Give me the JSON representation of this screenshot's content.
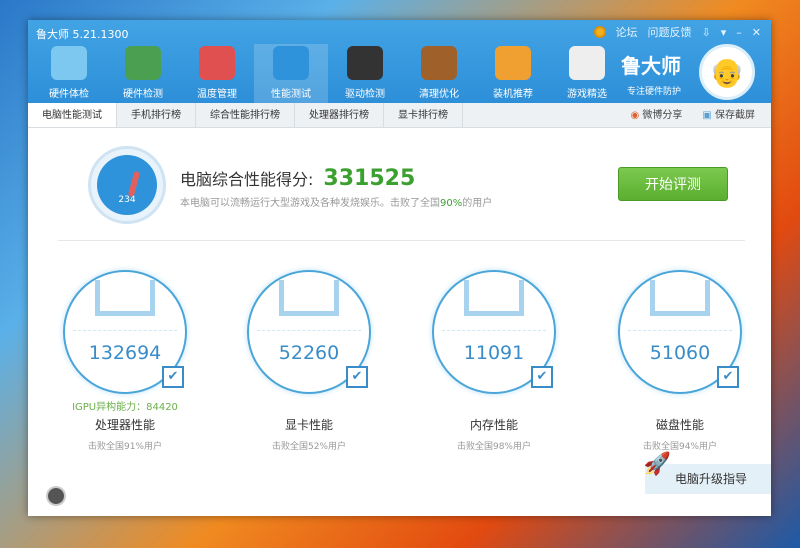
{
  "app": {
    "title": "鲁大师 5.21.1300"
  },
  "top_links": {
    "forum": "论坛",
    "feedback": "问题反馈"
  },
  "nav": [
    {
      "label": "硬件体检",
      "icon": "monitor-icon"
    },
    {
      "label": "硬件检测",
      "icon": "graphics-card-icon"
    },
    {
      "label": "温度管理",
      "icon": "thermometer-icon"
    },
    {
      "label": "性能测试",
      "icon": "speedometer-icon"
    },
    {
      "label": "驱动检测",
      "icon": "gear-icon"
    },
    {
      "label": "清理优化",
      "icon": "broom-icon"
    },
    {
      "label": "装机推荐",
      "icon": "cube-icon"
    },
    {
      "label": "游戏精选",
      "icon": "gamepad-icon"
    }
  ],
  "brand": {
    "name": "鲁大师",
    "slogan": "专注硬件防护"
  },
  "tabs": [
    "电脑性能测试",
    "手机排行榜",
    "综合性能排行榜",
    "处理器排行榜",
    "显卡排行榜"
  ],
  "tab_actions": {
    "share": "微博分享",
    "screenshot": "保存截屏"
  },
  "score": {
    "label": "电脑综合性能得分:",
    "value": "331525",
    "desc_pre": "本电脑可以流畅运行大型游戏及各种发烧娱乐。击败了全国",
    "percent": "90%",
    "desc_post": "的用户",
    "gauge_text": "234"
  },
  "start_button": "开始评测",
  "cards": [
    {
      "value": "132694",
      "extra": "IGPU异构能力：84420",
      "name": "处理器性能",
      "sub": "击败全国91%用户"
    },
    {
      "value": "52260",
      "extra": "",
      "name": "显卡性能",
      "sub": "击败全国52%用户"
    },
    {
      "value": "11091",
      "extra": "",
      "name": "内存性能",
      "sub": "击败全国98%用户"
    },
    {
      "value": "51060",
      "extra": "",
      "name": "磁盘性能",
      "sub": "击败全国94%用户"
    }
  ],
  "upgrade": "电脑升级指导"
}
